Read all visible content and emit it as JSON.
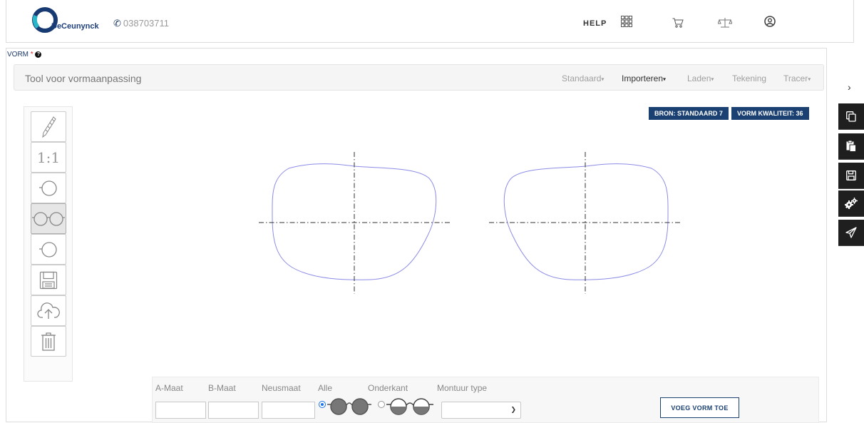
{
  "header": {
    "brand": "DeCeunynck",
    "phone": "038703711",
    "help": "HELP"
  },
  "vorm": {
    "label": "VORM",
    "required_mark": "*",
    "info_glyph": "?"
  },
  "toolhead": {
    "title": "Tool voor vormaanpassing",
    "menus": [
      "Standaard",
      "Importeren",
      "Laden",
      "Tekening",
      "Tracer"
    ],
    "active_menu": "Importeren"
  },
  "tools": {
    "scale_label": "1:1"
  },
  "badges": {
    "bron": "BRON: STANDAARD 7",
    "kwaliteit": "VORM KWALITEIT: 36"
  },
  "form": {
    "a_maat": "A-Maat",
    "b_maat": "B-Maat",
    "neusmaat": "Neusmaat",
    "alle": "Alle",
    "onderkant": "Onderkant",
    "montuur_type": "Montuur type",
    "selected_radio": "Alle",
    "add_button": "VOEG VORM TOE"
  },
  "colors": {
    "primary": "#1b4172",
    "lens_outline": "#8c8ce6",
    "radio": "#1a73e8"
  }
}
